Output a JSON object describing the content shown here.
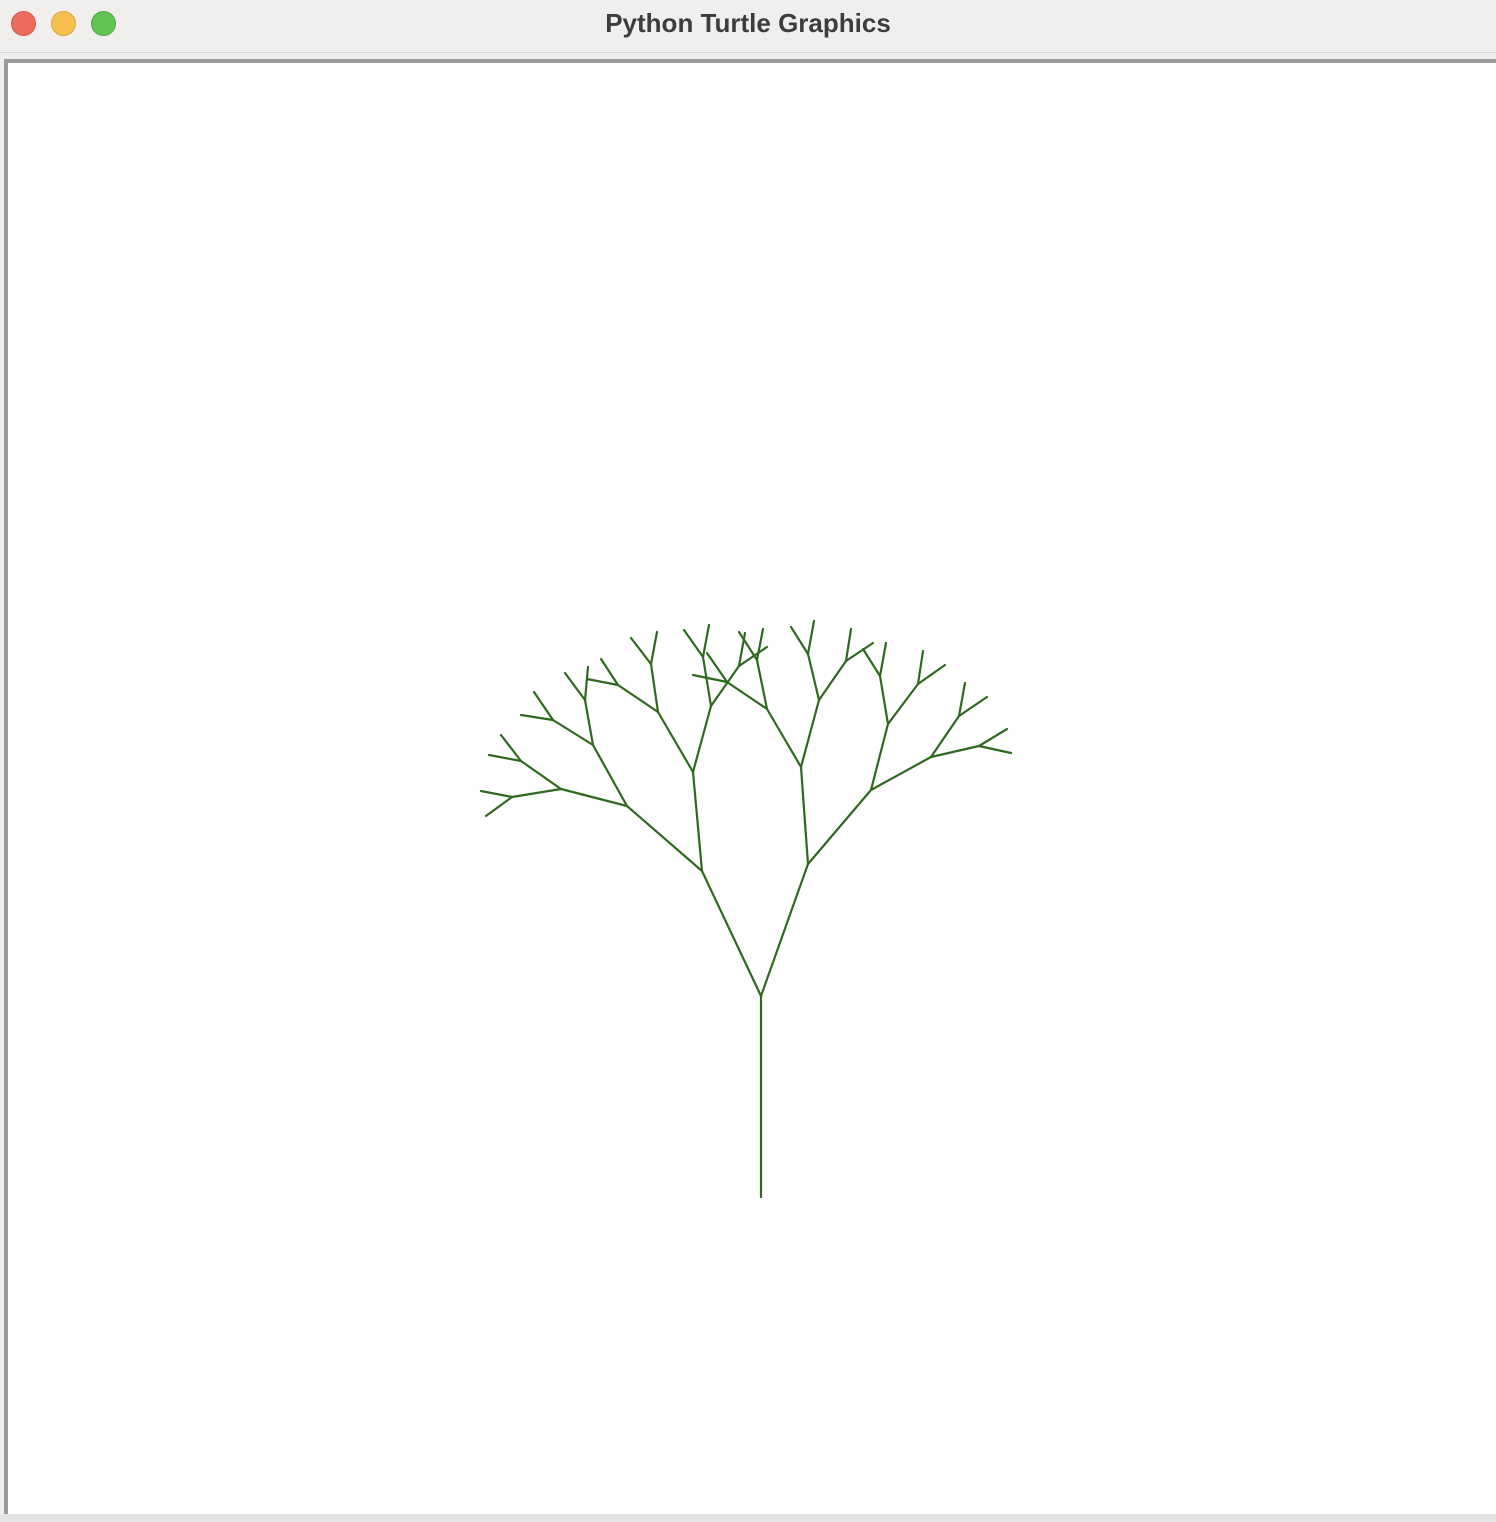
{
  "window": {
    "title": "Python Turtle Graphics"
  },
  "traffic_lights": {
    "close": "close-button",
    "minimize": "minimize-button",
    "zoom": "zoom-button",
    "close_color": "#ec6a5e",
    "minimize_color": "#f4bf4f",
    "zoom_color": "#61c554"
  },
  "canvas": {
    "background": "#ffffff",
    "pen_color": "#2d6a1f"
  }
}
